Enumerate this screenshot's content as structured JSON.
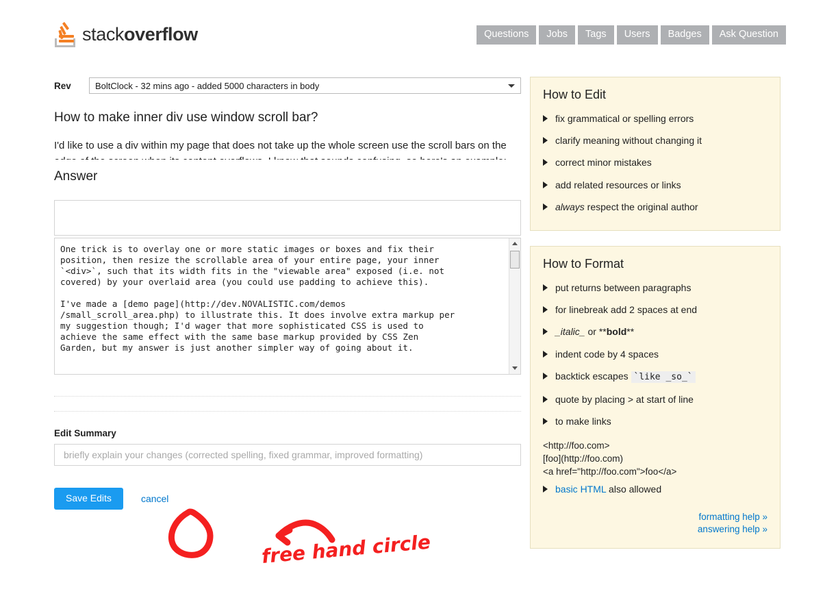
{
  "site": {
    "logo_text_light": "stack",
    "logo_text_bold": "overflow"
  },
  "topnav": {
    "items": [
      {
        "label": "Questions"
      },
      {
        "label": "Jobs"
      },
      {
        "label": "Tags"
      },
      {
        "label": "Users"
      },
      {
        "label": "Badges"
      },
      {
        "label": "Ask Question"
      }
    ],
    "bg_color": "#aeb0b3",
    "text_color": "#ffffff"
  },
  "revision": {
    "label": "Rev",
    "selected": "BoltClock - 32 mins ago - added 5000 characters in body"
  },
  "question": {
    "title": "How to make inner div use window scroll bar?",
    "body": "I'd like to use a div within my page that does not take up the whole screen use the scroll bars on the edge of the screen when its content overflows. I know that sounds confusing, so here's an example:"
  },
  "answer": {
    "heading": "Answer",
    "preview_text": "",
    "body": "One trick is to overlay one or more static images or boxes and fix their\nposition, then resize the scrollable area of your entire page, your inner\n`<div>`, such that its width fits in the \"viewable area\" exposed (i.e. not\ncovered) by your overlaid area (you could use padding to achieve this).\n\nI've made a [demo page](http://dev.NOVALISTIC.com/demos\n/small_scroll_area.php) to illustrate this. It does involve extra markup per\nmy suggestion though; I'd wager that more sophisticated CSS is used to\nachieve the same effect with the same base markup provided by CSS Zen\nGarden, but my answer is just another simpler way of going about it."
  },
  "edit_summary": {
    "label": "Edit Summary",
    "value": "",
    "placeholder": "briefly explain your changes (corrected spelling, fixed grammar, improved formatting)"
  },
  "actions": {
    "save_label": "Save Edits",
    "cancel_label": "cancel",
    "save_color": "#1a9bf0",
    "link_color": "#0077cc"
  },
  "how_to_edit": {
    "title": "How to Edit",
    "items": [
      {
        "text": "fix grammatical or spelling errors"
      },
      {
        "text": "clarify meaning without changing it"
      },
      {
        "text": "correct minor mistakes"
      },
      {
        "text": "add related resources or links"
      },
      {
        "emphasis": "always",
        "text": " respect the original author"
      }
    ]
  },
  "how_to_format": {
    "title": "How to Format",
    "items": [
      {
        "text": "put returns between paragraphs"
      },
      {
        "text": "for linebreak add 2 spaces at end"
      },
      {
        "italic": "_italic_",
        "mid": " or **",
        "bold": "bold",
        "tail": "**"
      },
      {
        "text": "indent code by 4 spaces"
      },
      {
        "text": "backtick escapes ",
        "code": "`like _so_`"
      },
      {
        "text": "quote by placing > at start of line"
      },
      {
        "text": "to make links"
      }
    ],
    "link_samples": [
      "<http://foo.com>",
      "[foo](http://foo.com)",
      "<a href=\"http://foo.com\">foo</a>"
    ],
    "html_note_link": "basic HTML",
    "html_note_tail": " also allowed",
    "help_links": [
      {
        "label": "formatting help »"
      },
      {
        "label": "answering help »"
      }
    ]
  },
  "annotation": {
    "text": "free hand circle",
    "color": "#f42020"
  },
  "panel_colors": {
    "background": "#fdf7e2",
    "border": "#e6dfbe"
  }
}
